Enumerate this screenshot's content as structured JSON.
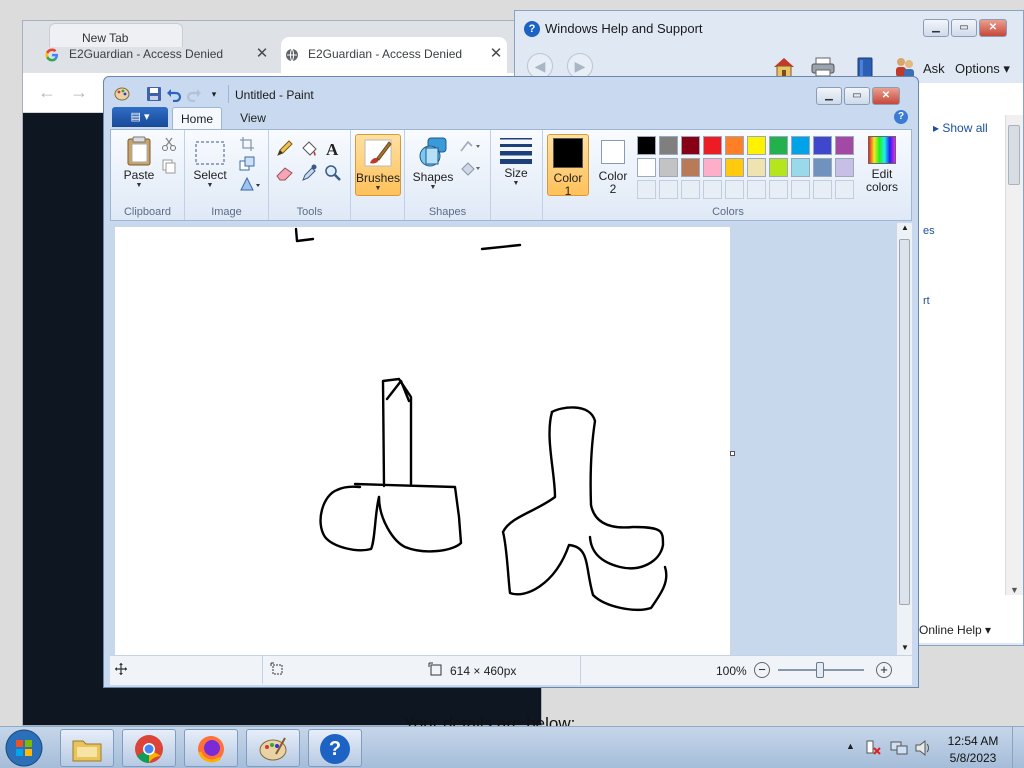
{
  "chrome": {
    "background_tab_title": "New Tab",
    "tabs": [
      {
        "title": "E2Guardian - Access Denied",
        "close": "✕"
      },
      {
        "title": "E2Guardian - Access Denied",
        "close": "✕"
      }
    ],
    "back": "←",
    "forward": "→",
    "page_text": "Your details are below:"
  },
  "help": {
    "title": "Windows Help and Support",
    "ask": "Ask",
    "options": "Options",
    "show_all": "Show all",
    "link1": "es",
    "link2": "rt",
    "footer": "Online Help"
  },
  "paint": {
    "title": "Untitled - Paint",
    "tabs": {
      "home": "Home",
      "view": "View"
    },
    "ribbon": {
      "clipboard": {
        "label": "Clipboard",
        "paste": "Paste"
      },
      "image": {
        "label": "Image",
        "select": "Select"
      },
      "tools": {
        "label": "Tools"
      },
      "brushes": "Brushes",
      "shapes": {
        "label": "Shapes",
        "button": "Shapes"
      },
      "size": "Size",
      "color1": {
        "line1": "Color",
        "line2": "1"
      },
      "color2": {
        "line1": "Color",
        "line2": "2"
      },
      "colors_label": "Colors",
      "edit_colors": {
        "line1": "Edit",
        "line2": "colors"
      }
    },
    "palette_row1": [
      "#000000",
      "#7f7f7f",
      "#880015",
      "#ed1c24",
      "#ff7f27",
      "#fff200",
      "#22b14c",
      "#00a2e8",
      "#3f48cc",
      "#a349a4"
    ],
    "palette_row2": [
      "#ffffff",
      "#c3c3c3",
      "#b97a57",
      "#ffaec9",
      "#ffc90e",
      "#efe4b0",
      "#b5e61d",
      "#99d9ea",
      "#7092be",
      "#c8bfe7"
    ],
    "color1_value": "#000000",
    "color2_value": "#ffffff",
    "status": {
      "size": "614 × 460px",
      "zoom": "100%"
    }
  },
  "taskbar": {
    "time": "12:54 AM",
    "date": "5/8/2023"
  }
}
